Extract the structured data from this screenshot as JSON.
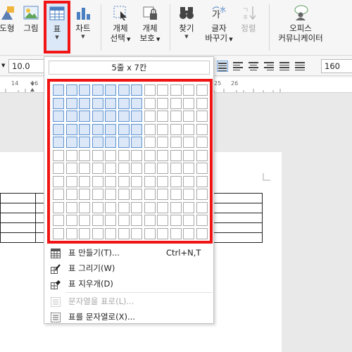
{
  "ribbon": {
    "shape_label": "도형",
    "picture_label": "그림",
    "table_label": "표",
    "chart_label": "차트",
    "select_object_label_1": "개체",
    "select_object_label_2": "선택",
    "protect_object_label_1": "개체",
    "protect_object_label_2": "보호",
    "find_label": "찾기",
    "replace_label_1": "글자",
    "replace_label_2": "바꾸기",
    "sort_label": "정렬",
    "office_comm_label_1": "오피스",
    "office_comm_label_2": "커뮤니케이터"
  },
  "format_bar": {
    "font_size": "10.0",
    "line_spacing": "160"
  },
  "ruler": {
    "ticks": [
      "14",
      "16",
      "25",
      "26"
    ]
  },
  "table_menu": {
    "grid_size_label": "5줄 x 7칸",
    "grid_rows": 12,
    "grid_cols": 12,
    "selected_rows": 5,
    "selected_cols": 7,
    "items": [
      {
        "label": "표 만들기(T)...",
        "shortcut": "Ctrl+N,T",
        "icon": "table-icon",
        "enabled": true
      },
      {
        "label": "표 그리기(W)",
        "shortcut": "",
        "icon": "pencil-table-icon",
        "enabled": true
      },
      {
        "label": "표 지우개(D)",
        "shortcut": "",
        "icon": "eraser-table-icon",
        "enabled": true
      },
      {
        "label": "문자열을 표로(L)...",
        "shortcut": "",
        "icon": "text-to-table-icon",
        "enabled": false
      },
      {
        "label": "표를 문자열로(X)...",
        "shortcut": "",
        "icon": "table-to-text-icon",
        "enabled": true
      }
    ]
  },
  "colors": {
    "highlight": "#f01414",
    "selected_cell": "#dce8f7",
    "selected_border": "#5f93d0",
    "accent": "#4a7fc1"
  }
}
